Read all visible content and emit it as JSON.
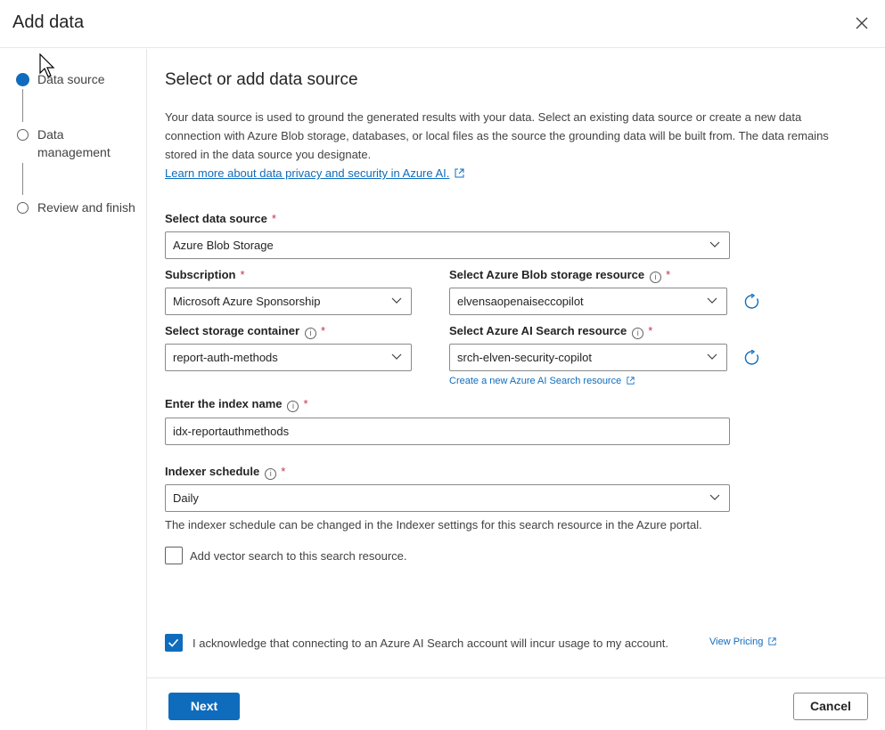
{
  "dialog": {
    "title": "Add data"
  },
  "steps": [
    {
      "label": "Data source",
      "state": "active"
    },
    {
      "label": "Data management",
      "state": "pending"
    },
    {
      "label": "Review and finish",
      "state": "pending"
    }
  ],
  "section": {
    "heading": "Select or add data source",
    "description": "Your data source is used to ground the generated results with your data. Select an existing data source or create a new data connection with Azure Blob storage, databases, or local files as the source the grounding data will be built from. The data remains stored in the data source you designate.",
    "privacy_link": "Learn more about data privacy and security in Azure AI."
  },
  "form": {
    "data_source": {
      "label": "Select data source",
      "value": "Azure Blob Storage"
    },
    "subscription": {
      "label": "Subscription",
      "value": "Microsoft Azure Sponsorship"
    },
    "blob_resource": {
      "label": "Select Azure Blob storage resource",
      "value": "elvensaopenaiseccopilot"
    },
    "storage_container": {
      "label": "Select storage container",
      "value": "report-auth-methods"
    },
    "search_resource": {
      "label": "Select Azure AI Search resource",
      "value": "srch-elven-security-copilot",
      "create_link": "Create a new Azure AI Search resource"
    },
    "index_name": {
      "label": "Enter the index name",
      "value": "idx-reportauthmethods"
    },
    "indexer_schedule": {
      "label": "Indexer schedule",
      "value": "Daily",
      "hint": "The indexer schedule can be changed in the Indexer settings for this search resource in the Azure portal."
    },
    "vector_search": {
      "label": "Add vector search to this search resource.",
      "checked": false
    },
    "acknowledge": {
      "label": "I acknowledge that connecting to an Azure AI Search account will incur usage to my account.",
      "checked": true,
      "pricing_link": "View Pricing"
    },
    "required_mark": "*",
    "info_glyph": "i"
  },
  "buttons": {
    "next": "Next",
    "cancel": "Cancel"
  },
  "colors": {
    "accent": "#0f6cbd",
    "required": "#c4314b",
    "border": "#8a8a8a"
  }
}
